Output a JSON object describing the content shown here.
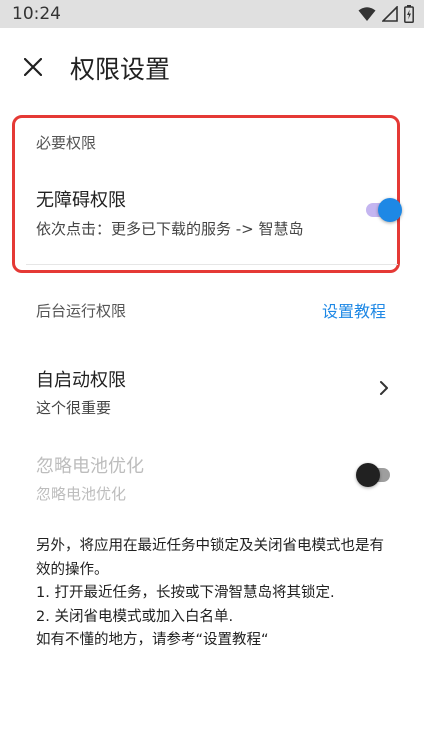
{
  "status_bar": {
    "time": "10:24"
  },
  "header": {
    "title": "权限设置"
  },
  "required": {
    "section_label": "必要权限",
    "accessibility": {
      "title": "无障碍权限",
      "subtitle": "依次点击：更多已下载的服务 -> 智慧岛",
      "enabled": true
    }
  },
  "background": {
    "label": "后台运行权限",
    "tutorial_link": "设置教程"
  },
  "autostart": {
    "title": "自启动权限",
    "subtitle": "这个很重要"
  },
  "battery": {
    "title": "忽略电池优化",
    "subtitle": "忽略电池优化",
    "enabled": false
  },
  "note_lines": [
    "另外，将应用在最近任务中锁定及关闭省电模式也是有效的操作。",
    "1. 打开最近任务，长按或下滑智慧岛将其锁定.",
    "2. 关闭省电模式或加入白名单.",
    "如有不懂的地方，请参考“设置教程“"
  ],
  "colors": {
    "accent": "#1e88e5",
    "highlight": "#e53935",
    "track_on": "#c4b5f0"
  }
}
